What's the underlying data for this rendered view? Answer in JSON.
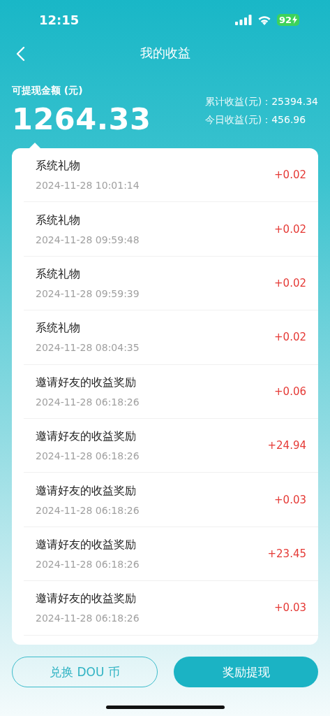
{
  "status_bar": {
    "time": "12:15",
    "battery": "92"
  },
  "nav": {
    "title": "我的收益"
  },
  "balance": {
    "label": "可提现金额 (元)",
    "amount": "1264.33",
    "stats": [
      {
        "label": "累计收益(元)：",
        "value": "25394.34"
      },
      {
        "label": "今日收益(元)：",
        "value": "456.96"
      }
    ]
  },
  "records": [
    {
      "title": "系统礼物",
      "time": "2024-11-28 10:01:14",
      "amount": "+0.02"
    },
    {
      "title": "系统礼物",
      "time": "2024-11-28 09:59:48",
      "amount": "+0.02"
    },
    {
      "title": "系统礼物",
      "time": "2024-11-28 09:59:39",
      "amount": "+0.02"
    },
    {
      "title": "系统礼物",
      "time": "2024-11-28 08:04:35",
      "amount": "+0.02"
    },
    {
      "title": "邀请好友的收益奖励",
      "time": "2024-11-28 06:18:26",
      "amount": "+0.06"
    },
    {
      "title": "邀请好友的收益奖励",
      "time": "2024-11-28 06:18:26",
      "amount": "+24.94"
    },
    {
      "title": "邀请好友的收益奖励",
      "time": "2024-11-28 06:18:26",
      "amount": "+0.03"
    },
    {
      "title": "邀请好友的收益奖励",
      "time": "2024-11-28 06:18:26",
      "amount": "+23.45"
    },
    {
      "title": "邀请好友的收益奖励",
      "time": "2024-11-28 06:18:26",
      "amount": "+0.03"
    }
  ],
  "buttons": [
    {
      "kind": "outline",
      "label": "兑换 DOU 币"
    },
    {
      "kind": "filled",
      "label": "奖励提现"
    }
  ]
}
